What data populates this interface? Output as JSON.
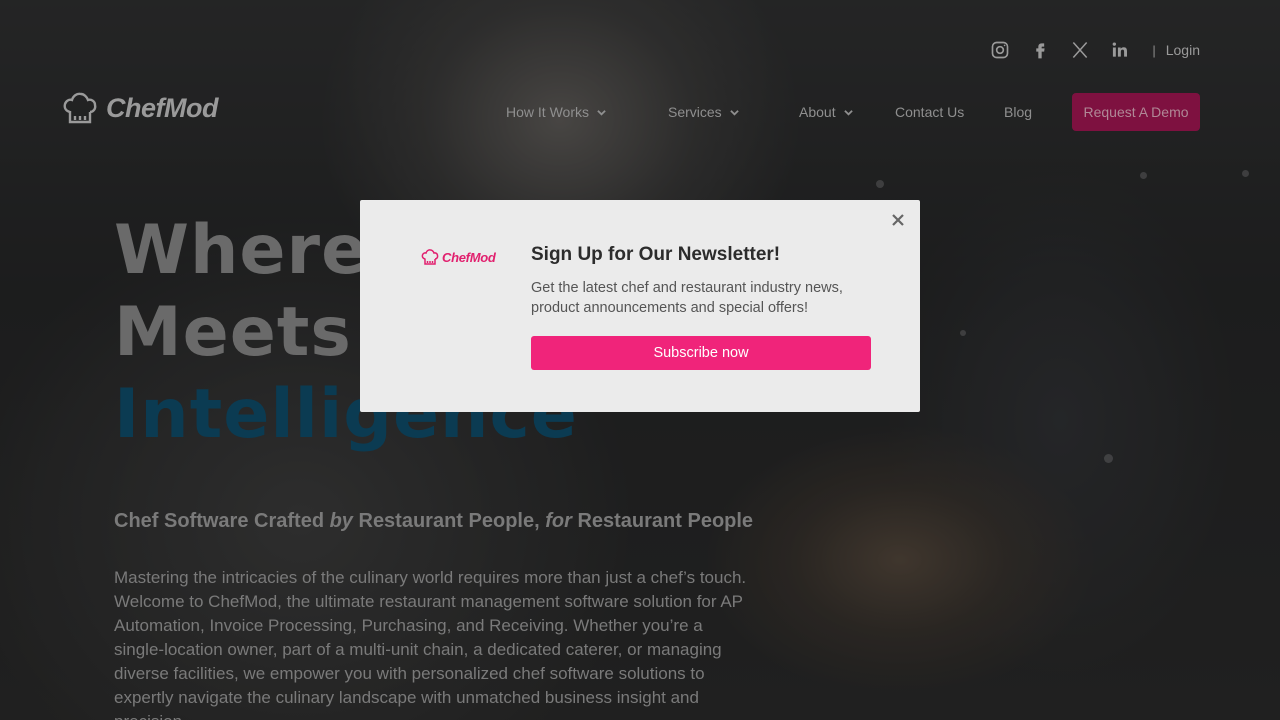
{
  "topbar": {
    "social_icons": [
      "instagram-icon",
      "facebook-icon",
      "x-twitter-icon",
      "linkedin-icon"
    ],
    "separator": "|",
    "login_label": "Login"
  },
  "header": {
    "logo_text": "ChefMod",
    "nav": [
      {
        "label": "How It Works",
        "has_dropdown": true
      },
      {
        "label": "Services",
        "has_dropdown": true
      },
      {
        "label": "About",
        "has_dropdown": true
      },
      {
        "label": "Contact Us",
        "has_dropdown": false
      },
      {
        "label": "Blog",
        "has_dropdown": false
      }
    ],
    "cta_label": "Request A Demo"
  },
  "hero": {
    "title_line1": "Where",
    "title_line2": "Meets",
    "title_line3": "Intelligence",
    "tagline_part1": "Chef Software Crafted ",
    "tagline_em1": "by",
    "tagline_part2": " Restaurant People, ",
    "tagline_em2": "for",
    "tagline_part3": " Restaurant People",
    "description": "Mastering the intricacies of the culinary world requires more than just a chef’s touch. Welcome to ChefMod, the ultimate restaurant management software solution for AP Automation, Invoice Processing, Purchasing, and Receiving. Whether you’re a single-location owner, part of a multi-unit chain, a dedicated caterer, or managing diverse facilities, we empower you with personalized chef software solutions to expertly navigate the culinary landscape with unmatched business insight and precision."
  },
  "modal": {
    "logo_text": "ChefMod",
    "heading": "Sign Up for Our Newsletter!",
    "body": "Get the latest chef and restaurant industry news, product announcements and special offers!",
    "button_label": "Subscribe now"
  },
  "colors": {
    "brand_pink": "#f0247a",
    "cta_dimmed": "#7e1140",
    "accent_blue_dimmed": "#0b3b52"
  }
}
